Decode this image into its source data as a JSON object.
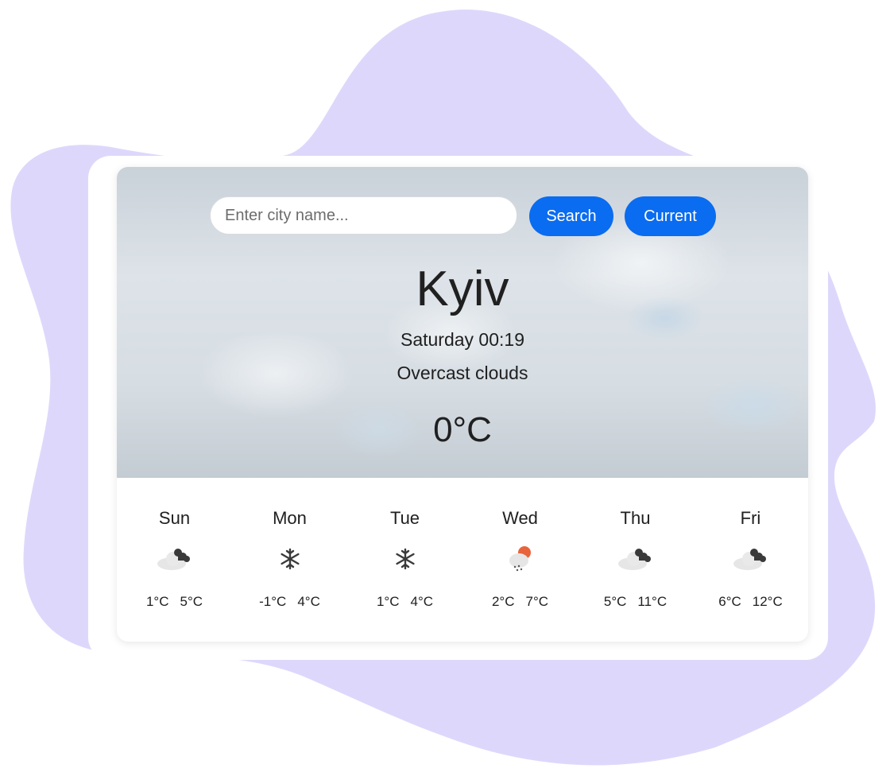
{
  "search": {
    "placeholder": "Enter city name...",
    "value": ""
  },
  "buttons": {
    "search_label": "Search",
    "current_label": "Current"
  },
  "accent_color": "#0a6cf0",
  "background_blob_color": "#ddd8fb",
  "weather": {
    "city": "Kyiv",
    "datetime": "Saturday 00:19",
    "description": "Overcast clouds",
    "temperature": "0°C"
  },
  "forecast": [
    {
      "day": "Sun",
      "icon": "cloudy-icon",
      "min": "1°C",
      "max": "5°C"
    },
    {
      "day": "Mon",
      "icon": "snowflake-icon",
      "min": "-1°C",
      "max": "4°C"
    },
    {
      "day": "Tue",
      "icon": "snowflake-icon",
      "min": "1°C",
      "max": "4°C"
    },
    {
      "day": "Wed",
      "icon": "sun-snow-cloud-icon",
      "min": "2°C",
      "max": "7°C"
    },
    {
      "day": "Thu",
      "icon": "cloudy-icon",
      "min": "5°C",
      "max": "11°C"
    },
    {
      "day": "Fri",
      "icon": "cloudy-icon",
      "min": "6°C",
      "max": "12°C"
    }
  ]
}
